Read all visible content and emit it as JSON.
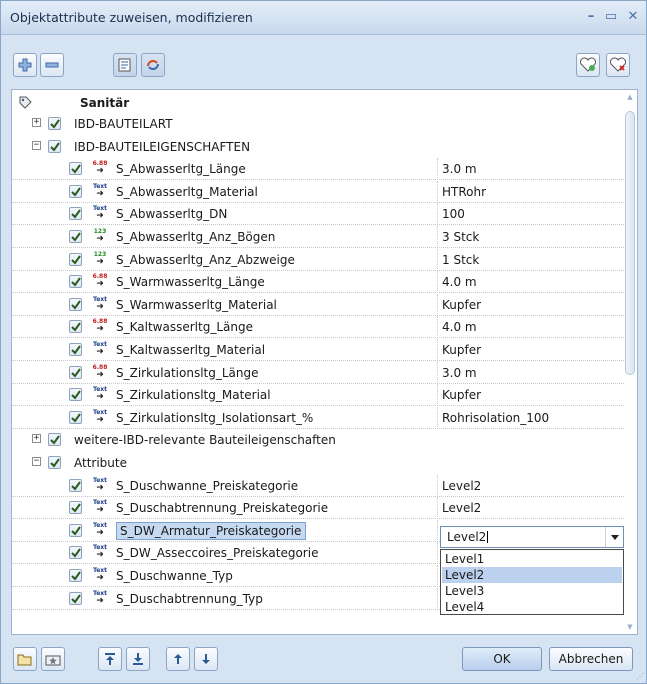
{
  "window": {
    "title": "Objektattribute zuweisen, modifizieren",
    "controls": [
      "–",
      "▭",
      "✕"
    ]
  },
  "toolbar": {
    "left_buttons": [
      "add-icon",
      "remove-icon",
      "attribute-list-icon",
      "refresh-icon"
    ],
    "right_buttons": [
      "add-favorite-icon",
      "delete-favorite-icon"
    ]
  },
  "tree": {
    "header": "Sanitär",
    "rows": [
      {
        "type": "group",
        "label": "IBD-BAUTEILART",
        "checked": true,
        "expanded": false
      },
      {
        "type": "group",
        "label": "IBD-BAUTEILEIGENSCHAFTEN",
        "checked": true,
        "expanded": true
      },
      {
        "type": "attr",
        "icon": "num",
        "icon_text": "6.88",
        "label": "S_Abwasserltg_Länge",
        "value": "3.0 m"
      },
      {
        "type": "attr",
        "icon": "txt",
        "icon_text": "Text",
        "label": "S_Abwasserltg_Material",
        "value": "HTRohr"
      },
      {
        "type": "attr",
        "icon": "txt",
        "icon_text": "Text",
        "label": "S_Abwasserltg_DN",
        "value": "100"
      },
      {
        "type": "attr",
        "icon": "cnt",
        "icon_text": "123",
        "label": "S_Abwasserltg_Anz_Bögen",
        "value": "3 Stck"
      },
      {
        "type": "attr",
        "icon": "cnt",
        "icon_text": "123",
        "label": "S_Abwasserltg_Anz_Abzweige",
        "value": "1 Stck"
      },
      {
        "type": "attr",
        "icon": "num",
        "icon_text": "6.88",
        "label": "S_Warmwasserltg_Länge",
        "value": "4.0 m"
      },
      {
        "type": "attr",
        "icon": "txt",
        "icon_text": "Text",
        "label": "S_Warmwasserltg_Material",
        "value": "Kupfer"
      },
      {
        "type": "attr",
        "icon": "num",
        "icon_text": "6.88",
        "label": "S_Kaltwasserltg_Länge",
        "value": "4.0 m"
      },
      {
        "type": "attr",
        "icon": "txt",
        "icon_text": "Text",
        "label": "S_Kaltwasserltg_Material",
        "value": "Kupfer"
      },
      {
        "type": "attr",
        "icon": "num",
        "icon_text": "6.88",
        "label": "S_Zirkulationsltg_Länge",
        "value": "3.0 m"
      },
      {
        "type": "attr",
        "icon": "txt",
        "icon_text": "Text",
        "label": "S_Zirkulationsltg_Material",
        "value": "Kupfer"
      },
      {
        "type": "attr",
        "icon": "txt",
        "icon_text": "Text",
        "label": "S_Zirkulationsltg_Isolationsart_%",
        "value": "Rohrisolation_100"
      },
      {
        "type": "group",
        "label": "weitere-IBD-relevante Bauteileigenschaften",
        "checked": true,
        "expanded": false
      },
      {
        "type": "group",
        "label": "Attribute",
        "checked": true,
        "expanded": true
      },
      {
        "type": "attr",
        "icon": "txt",
        "icon_text": "Text",
        "label": "S_Duschwanne_Preiskategorie",
        "value": "Level2"
      },
      {
        "type": "attr",
        "icon": "txt",
        "icon_text": "Text",
        "label": "S_Duschabtrennung_Preiskategorie",
        "value": "Level2"
      },
      {
        "type": "attr",
        "icon": "txt",
        "icon_text": "Text",
        "label": "S_DW_Armatur_Preiskategorie",
        "value": "",
        "selected": true
      },
      {
        "type": "attr",
        "icon": "txt",
        "icon_text": "Text",
        "label": "S_DW_Asseccoires_Preiskategorie",
        "value": ""
      },
      {
        "type": "attr",
        "icon": "txt",
        "icon_text": "Text",
        "label": "S_Duschwanne_Typ",
        "value": ""
      },
      {
        "type": "attr",
        "icon": "txt",
        "icon_text": "Text",
        "label": "S_Duschabtrennung_Typ",
        "value": ""
      }
    ]
  },
  "combo": {
    "value": "Level2",
    "options": [
      "Level1",
      "Level2",
      "Level3",
      "Level4"
    ],
    "selected_index": 1
  },
  "footer": {
    "ok_label": "OK",
    "cancel_label": "Abbrechen",
    "icon_buttons": [
      "open-folder-icon",
      "favorite-folder-icon",
      "move-top-icon",
      "move-bottom-icon",
      "move-up-icon",
      "move-down-icon"
    ]
  },
  "colors": {
    "window_bg": "#d6e3f2",
    "selection": "#bcd1ee",
    "check": "#2a5a1e"
  }
}
